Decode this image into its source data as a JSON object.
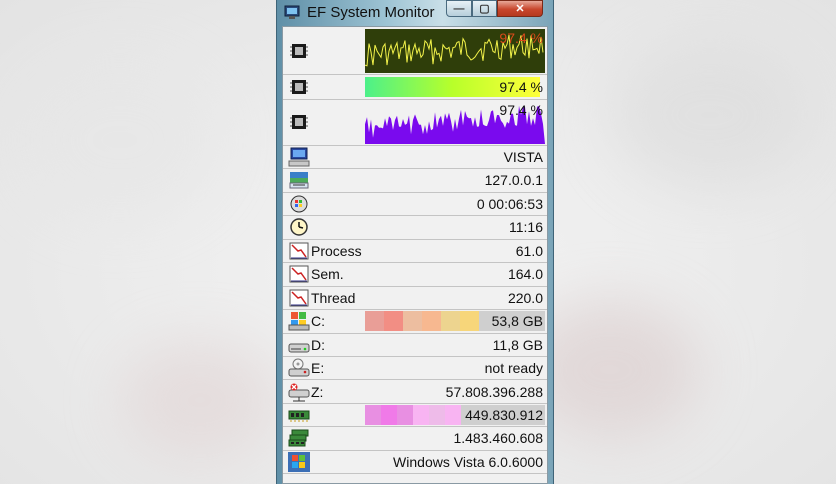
{
  "window": {
    "title": "EF System Monitor",
    "controls": {
      "minimize": "—",
      "maximize": "▢",
      "close": "✕"
    }
  },
  "graphs": [
    {
      "icon": "cpu-chip-icon",
      "value_text": "97.4 %",
      "style": "line-graph",
      "fill": "#2f3e0a",
      "line": "#f2f24a",
      "value_color": "#d94a1a"
    },
    {
      "icon": "cpu-chip-icon",
      "value_text": "97.4 %",
      "style": "gradient-bar",
      "percent": 97.4,
      "colors": [
        "#4cf08a",
        "#b8ff2a",
        "#ffff3a"
      ]
    },
    {
      "icon": "cpu-chip-icon",
      "value_text": "97.4 %",
      "style": "area-graph",
      "fill": "#7a0aee"
    }
  ],
  "rows": [
    {
      "icon": "computer-icon",
      "label": "",
      "value": "VISTA"
    },
    {
      "icon": "network-icon",
      "label": "",
      "value": "127.0.0.1"
    },
    {
      "icon": "uptime-windows-icon",
      "label": "",
      "value": "0   00:06:53"
    },
    {
      "icon": "clock-icon",
      "label": "",
      "value": "11:16"
    },
    {
      "icon": "stats-chart-icon",
      "label": "Process",
      "value": "61.0"
    },
    {
      "icon": "stats-chart-icon",
      "label": "Sem.",
      "value": "164.0"
    },
    {
      "icon": "stats-chart-icon",
      "label": "Thread",
      "value": "220.0"
    },
    {
      "icon": "windows-drive-icon",
      "label": "C:",
      "value": "53,8 GB",
      "bar": {
        "percent": 63,
        "colors": [
          "#f28e84",
          "#f7b890",
          "#f7d67a"
        ]
      }
    },
    {
      "icon": "hard-drive-icon",
      "label": "D:",
      "value": "11,8 GB"
    },
    {
      "icon": "cd-drive-icon",
      "label": "E:",
      "value": "not ready"
    },
    {
      "icon": "network-drive-icon",
      "label": "Z:",
      "value": "57.808.396.288"
    },
    {
      "icon": "memory-chip-icon",
      "label": "",
      "value": "449.830.912",
      "bar": {
        "percent": 53,
        "colors": [
          "#f07ae8",
          "#f8b4f2"
        ]
      }
    },
    {
      "icon": "memory-stack-icon",
      "label": "",
      "value": "1.483.460.608"
    },
    {
      "icon": "windows-logo-icon",
      "label": "",
      "value": "Windows Vista 6.0.6000"
    }
  ]
}
